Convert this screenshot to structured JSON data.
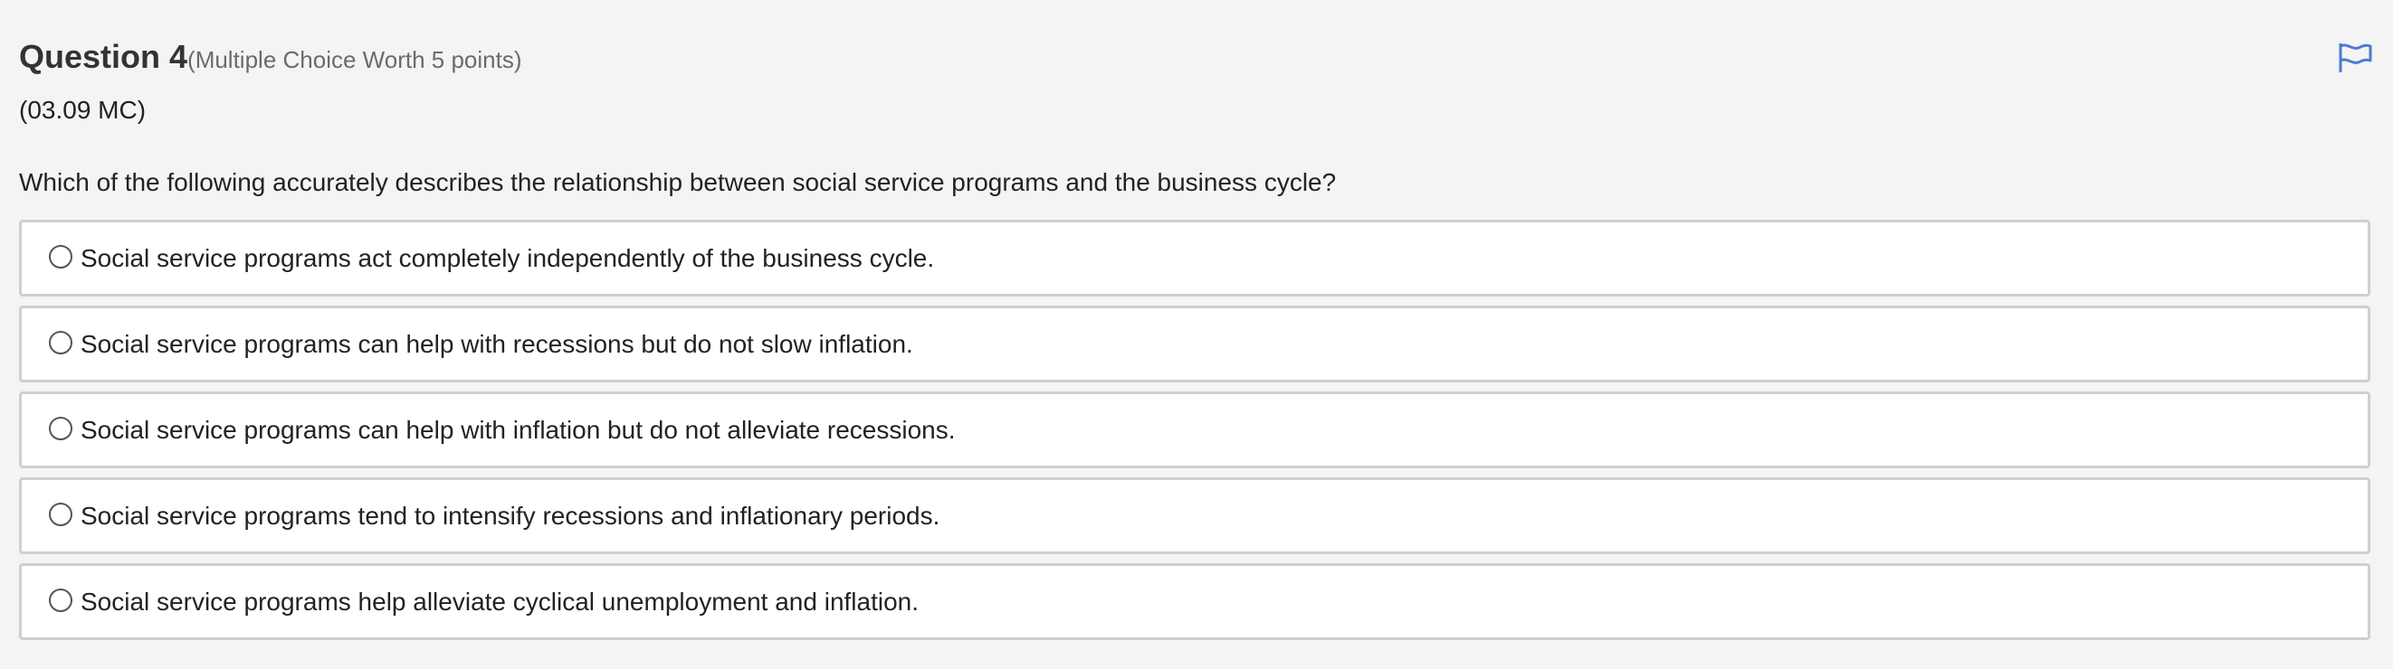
{
  "question": {
    "title": "Question 4",
    "worth": "(Multiple Choice Worth 5 points)",
    "code": "(03.09 MC)",
    "prompt": "Which of the following accurately describes the relationship between social service programs and the business cycle?"
  },
  "flag": {
    "icon": "flag-icon",
    "color": "#4a7bd0"
  },
  "options": [
    {
      "label": "Social service programs act completely independently of the business cycle.",
      "selected": false
    },
    {
      "label": "Social service programs can help with recessions but do not slow inflation.",
      "selected": false
    },
    {
      "label": "Social service programs can help with inflation but do not alleviate recessions.",
      "selected": false
    },
    {
      "label": "Social service programs tend to intensify recessions and inflationary periods.",
      "selected": false
    },
    {
      "label": "Social service programs help alleviate cyclical unemployment and inflation.",
      "selected": false
    }
  ]
}
